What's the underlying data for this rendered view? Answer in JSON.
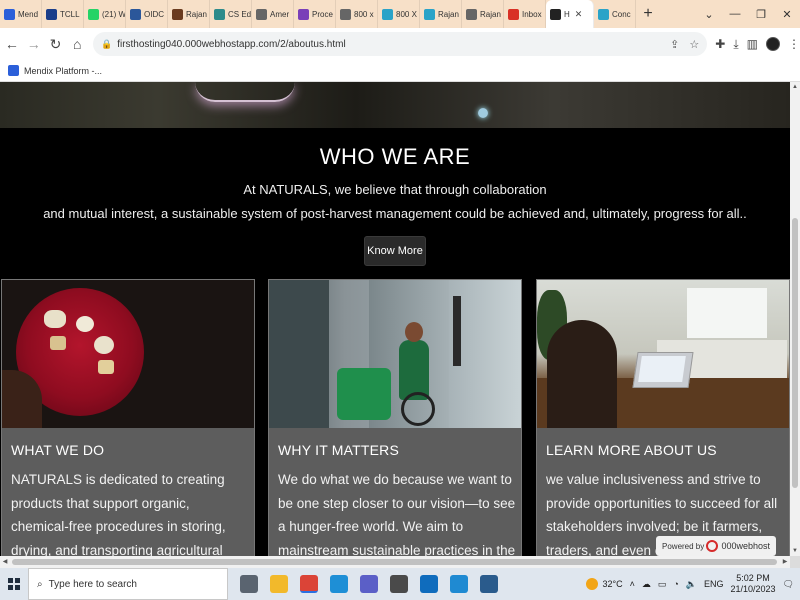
{
  "browser": {
    "tabs": [
      {
        "label": "Mend",
        "color": "#2b5fd9"
      },
      {
        "label": "TCLL",
        "color": "#1b3e8a"
      },
      {
        "label": "(21) W",
        "color": "#25d366"
      },
      {
        "label": "OIDC",
        "color": "#2b579a"
      },
      {
        "label": "Rajan",
        "color": "#6b3b1f"
      },
      {
        "label": "CS Ed",
        "color": "#2e8b8b"
      },
      {
        "label": "Amer",
        "color": "#666666"
      },
      {
        "label": "Proce",
        "color": "#7a3fb8"
      },
      {
        "label": "800 x",
        "color": "#666666"
      },
      {
        "label": "800 X",
        "color": "#2aa3c8"
      },
      {
        "label": "Rajan",
        "color": "#2aa3c8"
      },
      {
        "label": "Rajan",
        "color": "#666666"
      },
      {
        "label": "Inbox",
        "color": "#d93025"
      },
      {
        "label": "H",
        "color": "#222222",
        "active": true
      },
      {
        "label": "Conc",
        "color": "#2aa3c8"
      }
    ],
    "url": "firsthosting040.000webhostapp.com/2/aboutus.html",
    "bookmark": "Mendix Platform -..."
  },
  "page": {
    "who_title": "WHO WE ARE",
    "who_line1": "At NATURALS, we believe that through collaboration",
    "who_line2": "and mutual interest, a sustainable system of post-harvest management could be achieved and, ultimately, progress for all..",
    "know_more": "Know More",
    "cards": [
      {
        "title": "WHAT WE DO",
        "text": "NATURALS is dedicated to creating products that support organic, chemical-free procedures in storing, drying, and transporting agricultural commodities. It is"
      },
      {
        "title": "WHY IT MATTERS",
        "text": "We do what we do because we want to be one step closer to our vision—to see a hunger-free world. We aim to mainstream sustainable practices in the agricultural"
      },
      {
        "title": "LEARN MORE ABOUT US",
        "text": "we value inclusiveness and strive to provide opportunities to succeed for all stakeholders involved; be it farmers, traders, and even our employees.. We support, solve"
      }
    ],
    "powered_label": "Powered by",
    "powered_brand": "000webhost"
  },
  "taskbar": {
    "search_placeholder": "Type here to search",
    "temperature": "32°C",
    "language": "ENG",
    "time": "5:02 PM",
    "date": "21/10/2023",
    "apps": [
      {
        "name": "task-view",
        "color": "#5a6470"
      },
      {
        "name": "file-explorer",
        "color": "#f2b92b"
      },
      {
        "name": "chrome",
        "color": "#db4437",
        "active": true
      },
      {
        "name": "edge",
        "color": "#1e8fd6"
      },
      {
        "name": "teams",
        "color": "#5b5fc7"
      },
      {
        "name": "pen-app",
        "color": "#4a4a4a"
      },
      {
        "name": "outlook",
        "color": "#0f6cbd"
      },
      {
        "name": "vscode",
        "color": "#1f8ad2"
      },
      {
        "name": "photos",
        "color": "#2a5b8c"
      }
    ]
  }
}
